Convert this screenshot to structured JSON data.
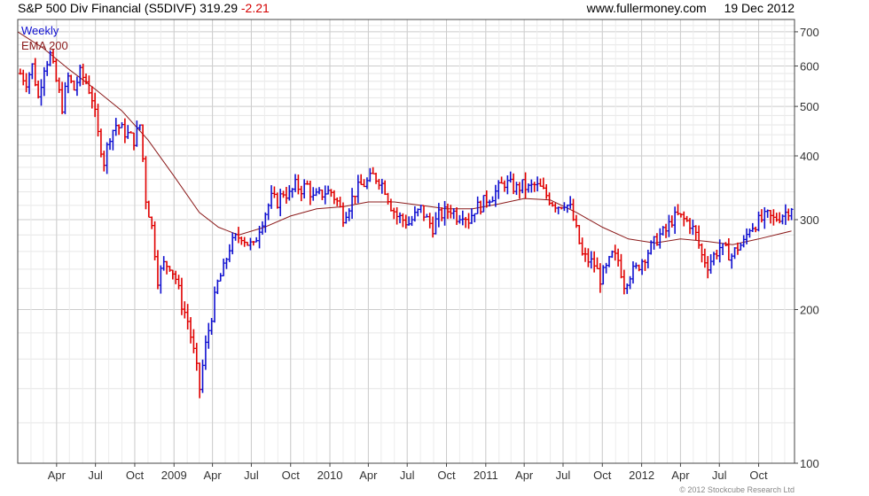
{
  "header": {
    "title": "S&P 500 Div Financial (S5DIVF)",
    "last": "319.29",
    "change": "-2.21",
    "site": "www.fullermoney.com",
    "date": "19 Dec 2012"
  },
  "legend": {
    "weekly": "Weekly",
    "ema": "EMA 200"
  },
  "copyright": "© 2012 Stockcube Research Ltd",
  "colors": {
    "up": "#1010d0",
    "down": "#e00000",
    "ema": "#8b1a1a",
    "grid": "#cccccc",
    "frame": "#444444"
  },
  "chart_data": {
    "type": "ohlc",
    "interval": "weekly",
    "ylim": [
      100,
      740
    ],
    "yticks": [
      100,
      200,
      300,
      400,
      500,
      600,
      700
    ],
    "y_scale": "log",
    "grid": true,
    "legend_position": "top-left",
    "xticks": [
      {
        "label": "Apr",
        "date": "2008-04-01"
      },
      {
        "label": "Jul",
        "date": "2008-07-01"
      },
      {
        "label": "Oct",
        "date": "2008-10-01"
      },
      {
        "label": "2009",
        "date": "2009-01-01"
      },
      {
        "label": "Apr",
        "date": "2009-04-01"
      },
      {
        "label": "Jul",
        "date": "2009-07-01"
      },
      {
        "label": "Oct",
        "date": "2009-10-01"
      },
      {
        "label": "2010",
        "date": "2010-01-01"
      },
      {
        "label": "Apr",
        "date": "2010-04-01"
      },
      {
        "label": "Jul",
        "date": "2010-07-01"
      },
      {
        "label": "Oct",
        "date": "2010-10-01"
      },
      {
        "label": "2011",
        "date": "2011-01-01"
      },
      {
        "label": "Apr",
        "date": "2011-04-01"
      },
      {
        "label": "Jul",
        "date": "2011-07-01"
      },
      {
        "label": "Oct",
        "date": "2011-10-01"
      },
      {
        "label": "2012",
        "date": "2012-01-01"
      },
      {
        "label": "Apr",
        "date": "2012-04-01"
      },
      {
        "label": "Jul",
        "date": "2012-07-01"
      },
      {
        "label": "Oct",
        "date": "2012-10-01"
      }
    ],
    "x_range": [
      "2008-01-01",
      "2012-12-24"
    ],
    "price_path": [
      [
        "2008-01-07",
        580
      ],
      [
        "2008-01-21",
        560
      ],
      [
        "2008-02-04",
        600
      ],
      [
        "2008-02-18",
        520
      ],
      [
        "2008-03-03",
        600
      ],
      [
        "2008-03-17",
        630
      ],
      [
        "2008-03-31",
        560
      ],
      [
        "2008-04-14",
        500
      ],
      [
        "2008-04-28",
        570
      ],
      [
        "2008-05-12",
        540
      ],
      [
        "2008-05-26",
        580
      ],
      [
        "2008-06-09",
        560
      ],
      [
        "2008-06-23",
        520
      ],
      [
        "2008-07-07",
        440
      ],
      [
        "2008-07-21",
        390
      ],
      [
        "2008-08-04",
        440
      ],
      [
        "2008-08-18",
        460
      ],
      [
        "2008-09-01",
        450
      ],
      [
        "2008-09-15",
        440
      ],
      [
        "2008-09-29",
        430
      ],
      [
        "2008-10-13",
        460
      ],
      [
        "2008-10-27",
        330
      ],
      [
        "2008-11-10",
        290
      ],
      [
        "2008-11-24",
        230
      ],
      [
        "2008-12-08",
        245
      ],
      [
        "2008-12-22",
        245
      ],
      [
        "2009-01-05",
        230
      ],
      [
        "2009-01-19",
        205
      ],
      [
        "2009-02-02",
        190
      ],
      [
        "2009-02-16",
        165
      ],
      [
        "2009-03-02",
        140
      ],
      [
        "2009-03-16",
        170
      ],
      [
        "2009-03-30",
        195
      ],
      [
        "2009-04-13",
        225
      ],
      [
        "2009-04-27",
        240
      ],
      [
        "2009-05-11",
        265
      ],
      [
        "2009-05-25",
        275
      ],
      [
        "2009-06-08",
        280
      ],
      [
        "2009-06-22",
        270
      ],
      [
        "2009-07-06",
        265
      ],
      [
        "2009-07-20",
        290
      ],
      [
        "2009-08-03",
        310
      ],
      [
        "2009-08-17",
        330
      ],
      [
        "2009-08-31",
        325
      ],
      [
        "2009-09-14",
        340
      ],
      [
        "2009-09-28",
        335
      ],
      [
        "2009-10-12",
        350
      ],
      [
        "2009-10-26",
        345
      ],
      [
        "2009-11-09",
        350
      ],
      [
        "2009-11-23",
        330
      ],
      [
        "2009-12-07",
        335
      ],
      [
        "2009-12-21",
        340
      ],
      [
        "2010-01-04",
        340
      ],
      [
        "2010-01-18",
        325
      ],
      [
        "2010-02-01",
        305
      ],
      [
        "2010-02-15",
        320
      ],
      [
        "2010-03-01",
        340
      ],
      [
        "2010-03-15",
        350
      ],
      [
        "2010-03-29",
        355
      ],
      [
        "2010-04-12",
        365
      ],
      [
        "2010-04-26",
        360
      ],
      [
        "2010-05-10",
        345
      ],
      [
        "2010-05-24",
        320
      ],
      [
        "2010-06-07",
        305
      ],
      [
        "2010-06-21",
        300
      ],
      [
        "2010-07-05",
        295
      ],
      [
        "2010-07-19",
        305
      ],
      [
        "2010-08-02",
        315
      ],
      [
        "2010-08-16",
        300
      ],
      [
        "2010-08-30",
        290
      ],
      [
        "2010-09-13",
        305
      ],
      [
        "2010-09-27",
        310
      ],
      [
        "2010-10-11",
        315
      ],
      [
        "2010-10-25",
        305
      ],
      [
        "2010-11-08",
        310
      ],
      [
        "2010-11-22",
        300
      ],
      [
        "2010-12-06",
        315
      ],
      [
        "2010-12-20",
        320
      ],
      [
        "2011-01-03",
        330
      ],
      [
        "2011-01-17",
        335
      ],
      [
        "2011-01-31",
        345
      ],
      [
        "2011-02-14",
        355
      ],
      [
        "2011-02-28",
        350
      ],
      [
        "2011-03-14",
        345
      ],
      [
        "2011-03-28",
        350
      ],
      [
        "2011-04-11",
        345
      ],
      [
        "2011-04-25",
        350
      ],
      [
        "2011-05-09",
        345
      ],
      [
        "2011-05-23",
        335
      ],
      [
        "2011-06-06",
        325
      ],
      [
        "2011-06-20",
        320
      ],
      [
        "2011-07-04",
        325
      ],
      [
        "2011-07-18",
        315
      ],
      [
        "2011-08-01",
        285
      ],
      [
        "2011-08-15",
        255
      ],
      [
        "2011-08-29",
        250
      ],
      [
        "2011-09-12",
        245
      ],
      [
        "2011-09-26",
        230
      ],
      [
        "2011-10-10",
        240
      ],
      [
        "2011-10-24",
        255
      ],
      [
        "2011-11-07",
        250
      ],
      [
        "2011-11-21",
        225
      ],
      [
        "2011-12-05",
        235
      ],
      [
        "2011-12-19",
        240
      ],
      [
        "2012-01-02",
        250
      ],
      [
        "2012-01-16",
        260
      ],
      [
        "2012-01-30",
        270
      ],
      [
        "2012-02-13",
        280
      ],
      [
        "2012-02-27",
        285
      ],
      [
        "2012-03-12",
        300
      ],
      [
        "2012-03-26",
        305
      ],
      [
        "2012-04-09",
        300
      ],
      [
        "2012-04-23",
        295
      ],
      [
        "2012-05-07",
        280
      ],
      [
        "2012-05-21",
        255
      ],
      [
        "2012-06-04",
        245
      ],
      [
        "2012-06-18",
        255
      ],
      [
        "2012-07-02",
        265
      ],
      [
        "2012-07-16",
        260
      ],
      [
        "2012-07-30",
        255
      ],
      [
        "2012-08-13",
        265
      ],
      [
        "2012-08-27",
        270
      ],
      [
        "2012-09-10",
        290
      ],
      [
        "2012-09-24",
        295
      ],
      [
        "2012-10-08",
        300
      ],
      [
        "2012-10-22",
        305
      ],
      [
        "2012-11-05",
        300
      ],
      [
        "2012-11-19",
        305
      ],
      [
        "2012-12-03",
        310
      ],
      [
        "2012-12-17",
        319
      ]
    ],
    "ema_path": [
      [
        "2008-01-01",
        700
      ],
      [
        "2008-03-01",
        650
      ],
      [
        "2008-05-01",
        590
      ],
      [
        "2008-07-01",
        540
      ],
      [
        "2008-09-01",
        490
      ],
      [
        "2008-11-01",
        430
      ],
      [
        "2009-01-01",
        365
      ],
      [
        "2009-03-01",
        310
      ],
      [
        "2009-04-15",
        290
      ],
      [
        "2009-06-01",
        280
      ],
      [
        "2009-08-01",
        290
      ],
      [
        "2009-10-01",
        305
      ],
      [
        "2009-12-01",
        315
      ],
      [
        "2010-02-01",
        318
      ],
      [
        "2010-04-01",
        325
      ],
      [
        "2010-06-01",
        325
      ],
      [
        "2010-08-01",
        320
      ],
      [
        "2010-10-01",
        315
      ],
      [
        "2010-12-01",
        315
      ],
      [
        "2011-02-01",
        322
      ],
      [
        "2011-04-01",
        330
      ],
      [
        "2011-06-01",
        328
      ],
      [
        "2011-08-01",
        310
      ],
      [
        "2011-10-01",
        290
      ],
      [
        "2011-12-01",
        275
      ],
      [
        "2012-02-01",
        270
      ],
      [
        "2012-04-01",
        275
      ],
      [
        "2012-06-01",
        272
      ],
      [
        "2012-08-01",
        268
      ],
      [
        "2012-10-01",
        275
      ],
      [
        "2012-12-17",
        285
      ]
    ]
  }
}
